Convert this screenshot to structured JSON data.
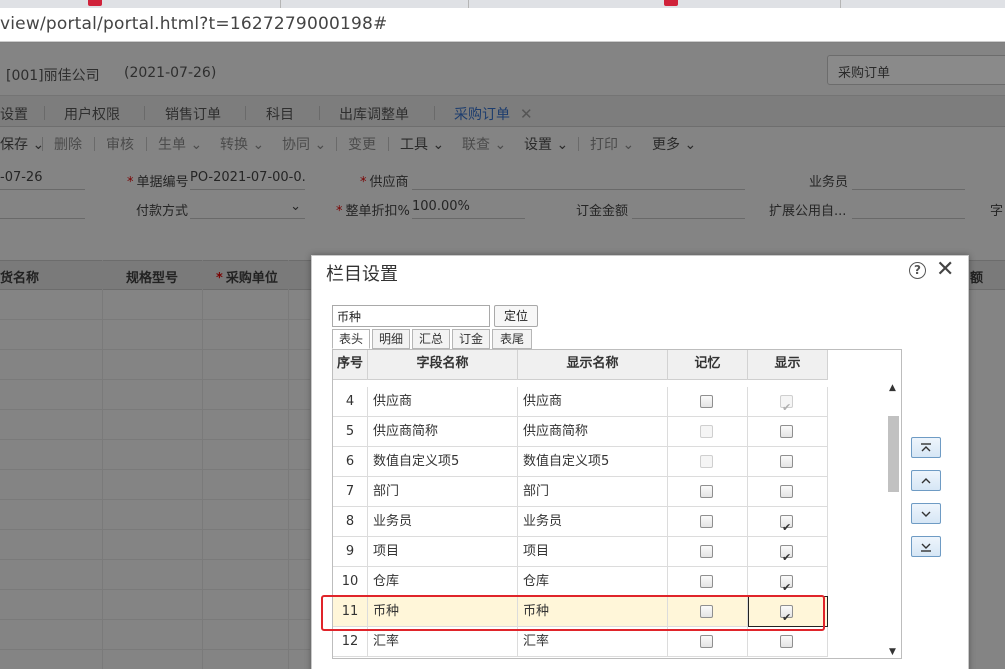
{
  "browser": {
    "url": "view/portal/portal.html?t=1627279000198#"
  },
  "app": {
    "company": "[001]丽佳公司",
    "date": "(2021-07-26)",
    "module_select": "采购订单"
  },
  "nav_tabs": [
    {
      "label": "设置"
    },
    {
      "label": "用户权限"
    },
    {
      "label": "销售订单"
    },
    {
      "label": "科目"
    },
    {
      "label": "出库调整单"
    },
    {
      "label": "采购订单"
    }
  ],
  "toolbar": {
    "save": "保存",
    "delete": "删除",
    "audit": "审核",
    "generate": "生单",
    "convert": "转换",
    "collab": "协同",
    "change": "变更",
    "tools": "工具",
    "query": "联查",
    "settings": "设置",
    "print": "打印",
    "more": "更多"
  },
  "form": {
    "date_value": "-07-26",
    "bill_no_label": "单据编号",
    "bill_no_value": "PO-2021-07-00-0...",
    "supplier_label": "供应商",
    "salesman_label": "业务员",
    "payment_label": "付款方式",
    "discount_label": "整单折扣%",
    "discount_value": "100.00%",
    "deposit_label": "订金金额",
    "ext_label": "扩展公用自...",
    "cut_label": "字"
  },
  "grid": {
    "col1": "货名称",
    "col2": "规格型号",
    "col3": "采购单位",
    "col_right": "额"
  },
  "modal": {
    "title": "栏目设置",
    "search_value": "币种",
    "locate_label": "定位",
    "sub_tabs": [
      "表头",
      "明细",
      "汇总",
      "订金",
      "表尾"
    ],
    "headers": {
      "seq": "序号",
      "field": "字段名称",
      "display": "显示名称",
      "remember": "记忆",
      "show": "显示"
    },
    "rows": [
      {
        "seq": "4",
        "field": "供应商",
        "display": "供应商",
        "remember": false,
        "remember_disabled": false,
        "show": true,
        "show_disabled": true
      },
      {
        "seq": "5",
        "field": "供应商简称",
        "display": "供应商简称",
        "remember": false,
        "remember_disabled": true,
        "show": false,
        "show_disabled": false
      },
      {
        "seq": "6",
        "field": "数值自定义项5",
        "display": "数值自定义项5",
        "remember": false,
        "remember_disabled": true,
        "show": false,
        "show_disabled": false
      },
      {
        "seq": "7",
        "field": "部门",
        "display": "部门",
        "remember": false,
        "remember_disabled": false,
        "show": false,
        "show_disabled": false
      },
      {
        "seq": "8",
        "field": "业务员",
        "display": "业务员",
        "remember": false,
        "remember_disabled": false,
        "show": true,
        "show_disabled": false
      },
      {
        "seq": "9",
        "field": "项目",
        "display": "项目",
        "remember": false,
        "remember_disabled": false,
        "show": true,
        "show_disabled": false
      },
      {
        "seq": "10",
        "field": "仓库",
        "display": "仓库",
        "remember": false,
        "remember_disabled": false,
        "show": true,
        "show_disabled": false
      },
      {
        "seq": "11",
        "field": "币种",
        "display": "币种",
        "remember": false,
        "remember_disabled": false,
        "show": true,
        "show_disabled": false
      },
      {
        "seq": "12",
        "field": "汇率",
        "display": "汇率",
        "remember": false,
        "remember_disabled": false,
        "show": false,
        "show_disabled": false
      }
    ],
    "selected_row_index": 7
  },
  "colors": {
    "highlight_border": "#e0242a",
    "selected_row_bg": "#fff6d9",
    "active_tab": "#1e4f8f"
  }
}
